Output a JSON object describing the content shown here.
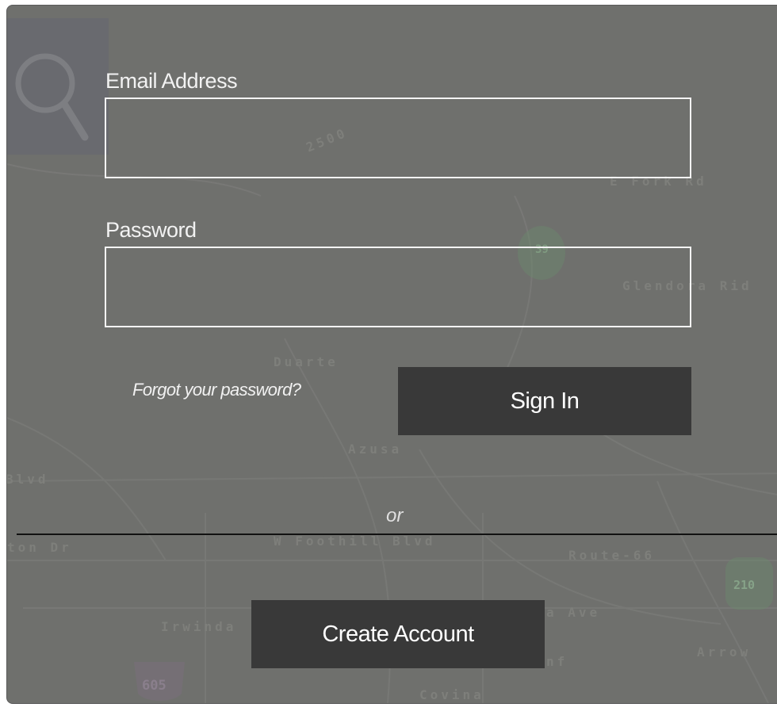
{
  "map": {
    "labels": {
      "elev": "2500",
      "efork": "E Fork Rd",
      "glendora": "Glendora Rid",
      "duarte": "Duarte",
      "azusa": "Azusa",
      "blvd": "Blvd",
      "wfoothill": "W Foothill Blvd",
      "route66": "Route-66",
      "tondr": "ton Dr",
      "irwinda": "Irwinda",
      "aave": "a Ave",
      "arrow": "Arrow",
      "nf": "nf",
      "covina": "Covina"
    },
    "shields": {
      "s39": "39",
      "s210": "210",
      "s605": "605"
    }
  },
  "form": {
    "email_label": "Email Address",
    "email_value": "",
    "email_placeholder": "",
    "password_label": "Password",
    "password_value": "",
    "password_placeholder": "",
    "forgot_link": "Forgot your password?",
    "sign_in_label": "Sign In",
    "or_text": "or",
    "create_account_label": "Create Account"
  },
  "colors": {
    "overlay": "#6f706d",
    "button": "#393939",
    "text": "#ffffff"
  }
}
